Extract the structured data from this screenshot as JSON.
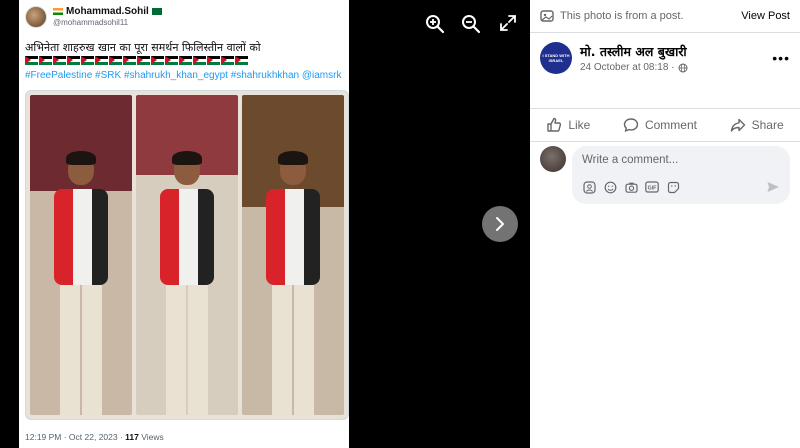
{
  "tweet": {
    "name": "Mohammad.Sohil",
    "handle": "@mohammadsohil11",
    "text": "अभिनेता शाहरुख खान का पूरा समर्थन फिलिस्तीन वालों को",
    "hashtags": "#FreePalestine #SRK #shahrukh_khan_egypt #shahrukhkhan @iamsrk",
    "timestamp": "12:19 PM · Oct 22, 2023 · ",
    "views_count": "117",
    "views_label": " Views"
  },
  "viewer": {
    "icons": [
      "zoom-in-icon",
      "zoom-out-icon",
      "expand-icon",
      "chevron-right-icon"
    ]
  },
  "side": {
    "note": "This photo is from a post.",
    "view_post": "View Post",
    "author": "मो. तस्लीम अल बुखारी",
    "date": "24 October at 08:18 ·",
    "avatar_text": "I STAND WITH ISRAEL",
    "actions": {
      "like": "Like",
      "comment": "Comment",
      "share": "Share"
    },
    "comment_placeholder": "Write a comment..."
  },
  "colors": {
    "hashtag": "#1d9bf0",
    "muted": "#65676b",
    "input_bg": "#f0f2f5"
  }
}
